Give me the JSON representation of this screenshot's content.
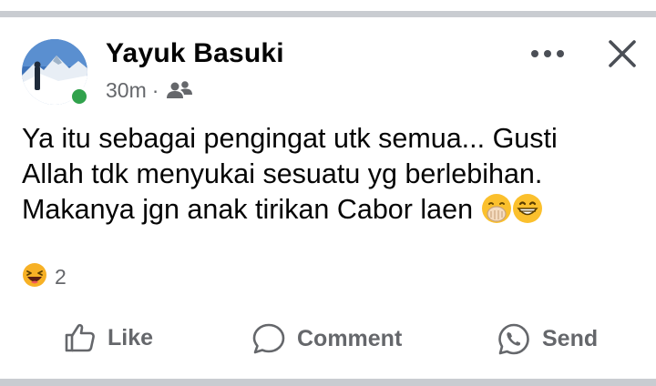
{
  "post": {
    "author": "Yayuk Basuki",
    "time": "30m",
    "separator": "·",
    "audience_icon": "friends-icon",
    "text_lines": [
      "Ya itu sebagai pengingat utk semua... Gusti",
      "Allah tdk menyukai sesuatu yg berlebihan.",
      "Makanya jgn anak tirikan Cabor laen"
    ],
    "text_emojis": [
      "hand-over-mouth-emoji",
      "grinning-face-emoji"
    ],
    "reaction_icon": "laughing-face-emoji",
    "reaction_count": "2"
  },
  "actions": {
    "like_label": "Like",
    "comment_label": "Comment",
    "send_label": "Send"
  },
  "colors": {
    "online": "#31a24c",
    "secondary_text": "#65676b",
    "primary_text": "#050505",
    "separator": "#c9ccd1"
  }
}
